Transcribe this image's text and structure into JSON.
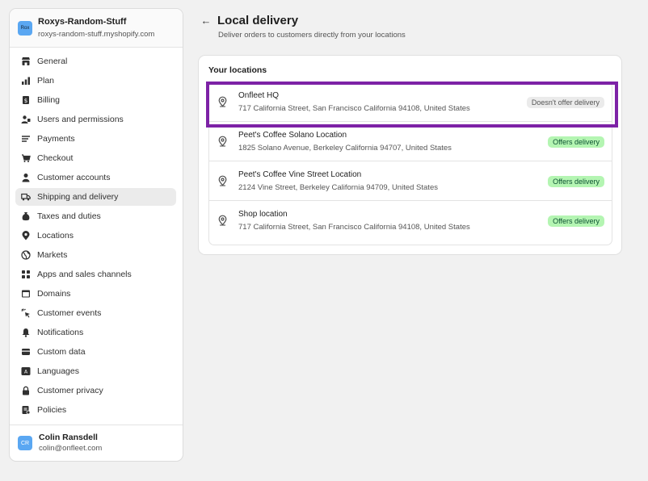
{
  "store": {
    "avatar": "Rox",
    "name": "Roxys-Random-Stuff",
    "url": "roxys-random-stuff.myshopify.com"
  },
  "nav": [
    {
      "label": "General",
      "icon": "store-icon"
    },
    {
      "label": "Plan",
      "icon": "chart-icon"
    },
    {
      "label": "Billing",
      "icon": "billing-icon"
    },
    {
      "label": "Users and permissions",
      "icon": "users-icon"
    },
    {
      "label": "Payments",
      "icon": "payments-icon"
    },
    {
      "label": "Checkout",
      "icon": "cart-icon"
    },
    {
      "label": "Customer accounts",
      "icon": "person-icon"
    },
    {
      "label": "Shipping and delivery",
      "icon": "truck-icon",
      "active": true
    },
    {
      "label": "Taxes and duties",
      "icon": "taxes-icon"
    },
    {
      "label": "Locations",
      "icon": "location-icon"
    },
    {
      "label": "Markets",
      "icon": "globe-icon"
    },
    {
      "label": "Apps and sales channels",
      "icon": "apps-icon"
    },
    {
      "label": "Domains",
      "icon": "domain-icon"
    },
    {
      "label": "Customer events",
      "icon": "cursor-icon"
    },
    {
      "label": "Notifications",
      "icon": "bell-icon"
    },
    {
      "label": "Custom data",
      "icon": "data-icon"
    },
    {
      "label": "Languages",
      "icon": "language-icon"
    },
    {
      "label": "Customer privacy",
      "icon": "lock-icon"
    },
    {
      "label": "Policies",
      "icon": "policy-icon"
    }
  ],
  "user": {
    "initials": "CR",
    "name": "Colin Ransdell",
    "email": "colin@onfleet.com"
  },
  "page": {
    "title": "Local delivery",
    "subtitle": "Deliver orders to customers directly from your locations"
  },
  "card": {
    "title": "Your locations",
    "locations": [
      {
        "name": "Onfleet HQ",
        "address": "717 California Street, San Francisco California 94108, United States",
        "status": "Doesn't offer delivery",
        "offers": false
      },
      {
        "name": "Peet's Coffee Solano Location",
        "address": "1825 Solano Avenue, Berkeley California 94707, United States",
        "status": "Offers delivery",
        "offers": true
      },
      {
        "name": "Peet's Coffee Vine Street Location",
        "address": "2124 Vine Street, Berkeley California 94709, United States",
        "status": "Offers delivery",
        "offers": true
      },
      {
        "name": "Shop location",
        "address": "717 California Street, San Francisco California 94108, United States",
        "status": "Offers delivery",
        "offers": true
      }
    ]
  },
  "colors": {
    "highlight": "#7d22a6",
    "badge_on_bg": "#b4f5b2",
    "badge_off_bg": "#ebebeb",
    "avatar": "#5aa7f2"
  }
}
